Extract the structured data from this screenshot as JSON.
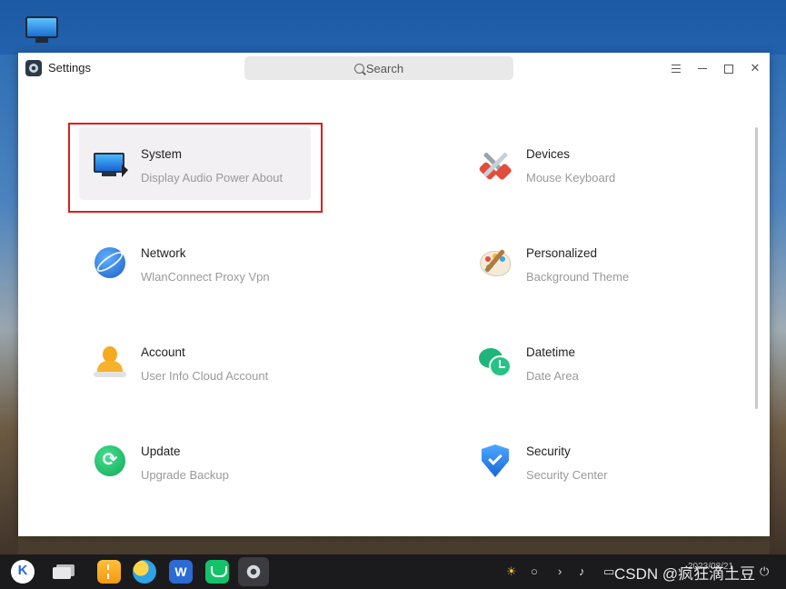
{
  "window": {
    "title": "Settings",
    "search_placeholder": "Search"
  },
  "cards": [
    {
      "name": "System",
      "sub": "Display Audio Power About",
      "icon": "monitor-icon"
    },
    {
      "name": "Devices",
      "sub": "Mouse Keyboard",
      "icon": "tools-icon"
    },
    {
      "name": "Network",
      "sub": "WlanConnect Proxy Vpn",
      "icon": "globe-icon"
    },
    {
      "name": "Personalized",
      "sub": "Background Theme",
      "icon": "palette-icon"
    },
    {
      "name": "Account",
      "sub": "User Info Cloud Account",
      "icon": "user-icon"
    },
    {
      "name": "Datetime",
      "sub": "Date Area",
      "icon": "clock-chat-icon"
    },
    {
      "name": "Update",
      "sub": "Upgrade Backup",
      "icon": "refresh-icon"
    },
    {
      "name": "Security",
      "sub": "Security Center",
      "icon": "shield-check-icon"
    }
  ],
  "taskbar": {
    "clock": "2023/08/21",
    "watermark": "CSDN @疯狂滴土豆"
  },
  "colors": {
    "highlight": "#e01b1b",
    "taskbar": "#1b1b1d"
  }
}
